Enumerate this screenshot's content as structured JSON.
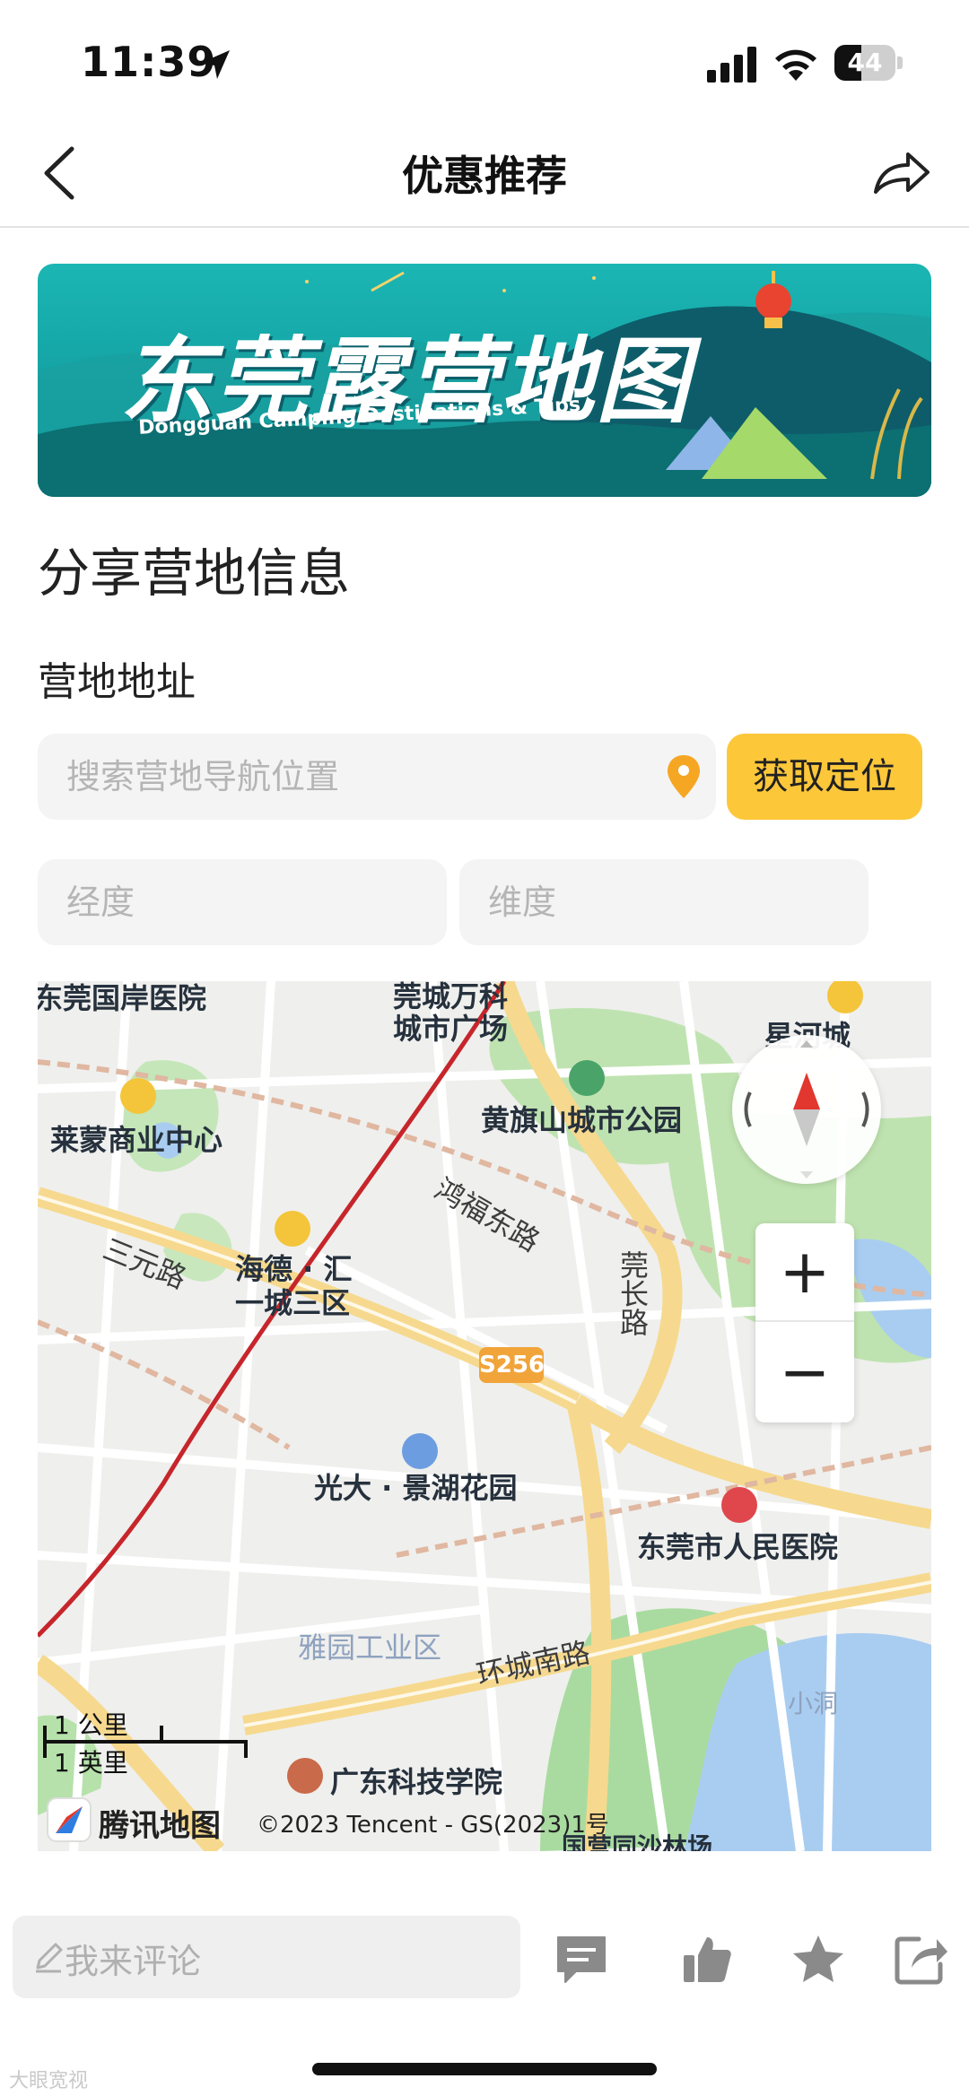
{
  "status_bar": {
    "time": "11:39",
    "battery": "44"
  },
  "nav": {
    "title": "优惠推荐"
  },
  "banner": {
    "title": "东莞露营地图",
    "subtitle": "Dongguan Camping Destinations & Tips"
  },
  "form": {
    "section_title": "分享营地信息",
    "address_label": "营地地址",
    "search_placeholder": "搜索营地导航位置",
    "locate_button": "获取定位",
    "longitude_placeholder": "经度",
    "latitude_placeholder": "维度"
  },
  "map": {
    "labels": [
      {
        "name": "dongguan-guoji-hospital",
        "text": "东莞国岸医院"
      },
      {
        "name": "guancheng-wanke",
        "text": "莞城万科"
      },
      {
        "name": "city-plaza",
        "text": "城市广场"
      },
      {
        "name": "xinghe-city",
        "text": "星河城"
      },
      {
        "name": "laimeng-center",
        "text": "莱蒙商业中心"
      },
      {
        "name": "huangqishan-park",
        "text": "黄旗山城市公园"
      },
      {
        "name": "haide-hui",
        "text": "海德 · 汇"
      },
      {
        "name": "yicheng-sanqu",
        "text": "一城三区"
      },
      {
        "name": "guangda-jinghu",
        "text": "光大 · 景湖花园"
      },
      {
        "name": "dongguan-peoples-hospital",
        "text": "东莞市人民医院"
      },
      {
        "name": "yayuan-industrial",
        "text": "雅园工业区"
      },
      {
        "name": "xiaodong",
        "text": "小洞"
      },
      {
        "name": "guangdong-keji",
        "text": "广东科技学院"
      },
      {
        "name": "guoyuan-forest",
        "text": "国营同沙林场"
      }
    ],
    "roads": {
      "sanyuan": "三元路",
      "hongfu": "鸿福东路",
      "guanchang": "莞长路",
      "huancheng_south": "环城南路",
      "route": "S256"
    },
    "zoom_in": "+",
    "zoom_out": "−",
    "scale_km": "1 公里",
    "scale_mi": "1 英里",
    "provider": "腾讯地图",
    "copyright": "©2023 Tencent - GS(2023)1号"
  },
  "bottom": {
    "comment_placeholder": "我来评论",
    "watermark": "大眼宽视"
  },
  "colors": {
    "accent_yellow": "#fdc73a",
    "pin_orange": "#f5a623",
    "banner_teal": "#1bb3b0"
  }
}
